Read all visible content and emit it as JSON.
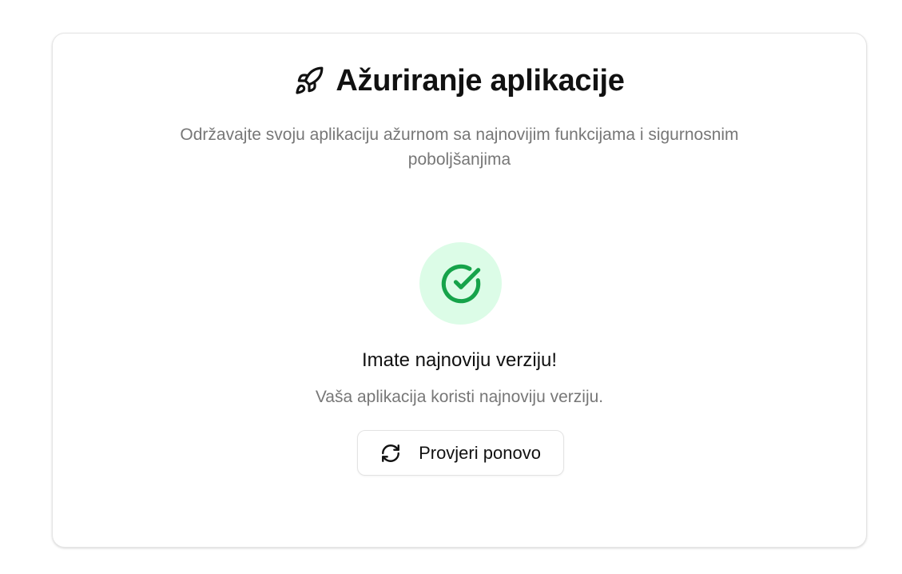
{
  "header": {
    "icon": "rocket-icon",
    "title": "Ažuriranje aplikacije",
    "subtitle": "Održavajte svoju aplikaciju ažurnom sa najnovijim funkcijama i sigurnosnim poboljšanjima"
  },
  "status": {
    "icon": "check-circle-icon",
    "title": "Imate najnoviju verziju!",
    "description": "Vaša aplikacija koristi najnoviju verziju."
  },
  "actions": {
    "check_again_icon": "refresh-icon",
    "check_again_label": "Provjeri ponovo"
  },
  "colors": {
    "success": "#16a34a",
    "success_bg": "#dcfce7",
    "muted_text": "#777777",
    "text": "#111111"
  }
}
